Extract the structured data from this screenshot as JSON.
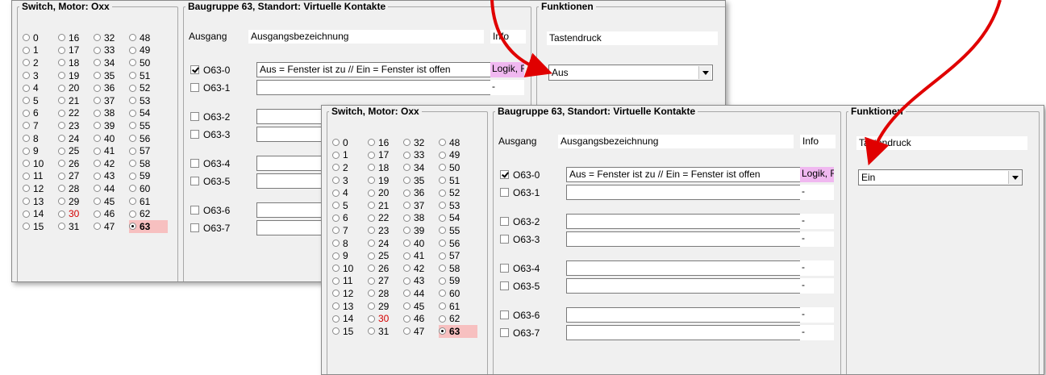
{
  "switch_group": {
    "legend": "Switch, Motor: Oxx",
    "options": [
      "0",
      "16",
      "32",
      "48",
      "1",
      "17",
      "33",
      "49",
      "2",
      "18",
      "34",
      "50",
      "3",
      "19",
      "35",
      "51",
      "4",
      "20",
      "36",
      "52",
      "5",
      "21",
      "37",
      "53",
      "6",
      "22",
      "38",
      "54",
      "7",
      "23",
      "39",
      "55",
      "8",
      "24",
      "40",
      "56",
      "9",
      "25",
      "41",
      "57",
      "10",
      "26",
      "42",
      "58",
      "11",
      "27",
      "43",
      "59",
      "12",
      "28",
      "44",
      "60",
      "13",
      "29",
      "45",
      "61",
      "14",
      "30",
      "46",
      "62",
      "15",
      "31",
      "47",
      "63"
    ],
    "selected": "63",
    "highlighted_red": "30"
  },
  "group": {
    "legend": "Baugruppe 63, Standort: Virtuelle Kontakte",
    "col_output": "Ausgang",
    "col_name": "Ausgangsbezeichnung",
    "col_info": "Info"
  },
  "functions": {
    "legend": "Funktionen",
    "header": "Tastendruck"
  },
  "panel_a": {
    "outputs": [
      {
        "label": "O63-0",
        "checked": true,
        "name": "Aus = Fenster ist zu // Ein = Fenster ist offen",
        "info": "Logik, F"
      },
      {
        "label": "O63-1",
        "checked": false,
        "name": "",
        "info": "-"
      },
      {
        "label": "O63-2",
        "checked": false,
        "name": "",
        "info": "-"
      },
      {
        "label": "O63-3",
        "checked": false,
        "name": "",
        "info": "-"
      },
      {
        "label": "O63-4",
        "checked": false,
        "name": "",
        "info": "-"
      },
      {
        "label": "O63-5",
        "checked": false,
        "name": "",
        "info": "-"
      },
      {
        "label": "O63-6",
        "checked": false,
        "name": "",
        "info": "-"
      },
      {
        "label": "O63-7",
        "checked": false,
        "name": "",
        "info": "-"
      }
    ],
    "select_value": "Aus"
  },
  "panel_b": {
    "outputs": [
      {
        "label": "O63-0",
        "checked": true,
        "name": "Aus = Fenster ist zu // Ein = Fenster ist offen",
        "info": "Logik, F"
      },
      {
        "label": "O63-1",
        "checked": false,
        "name": "",
        "info": "-"
      },
      {
        "label": "O63-2",
        "checked": false,
        "name": "",
        "info": "-"
      },
      {
        "label": "O63-3",
        "checked": false,
        "name": "",
        "info": "-"
      },
      {
        "label": "O63-4",
        "checked": false,
        "name": "",
        "info": "-"
      },
      {
        "label": "O63-5",
        "checked": false,
        "name": "",
        "info": "-"
      },
      {
        "label": "O63-6",
        "checked": false,
        "name": "",
        "info": "-"
      },
      {
        "label": "O63-7",
        "checked": false,
        "name": "",
        "info": "-"
      }
    ],
    "select_value": "Ein"
  },
  "colors": {
    "panel_bg": "#f0f0f0",
    "selected_bg": "#f7c0c0",
    "logic_bg": "#f0b8f0",
    "red_text": "#d40000",
    "annotation_arrow": "#e00000"
  }
}
